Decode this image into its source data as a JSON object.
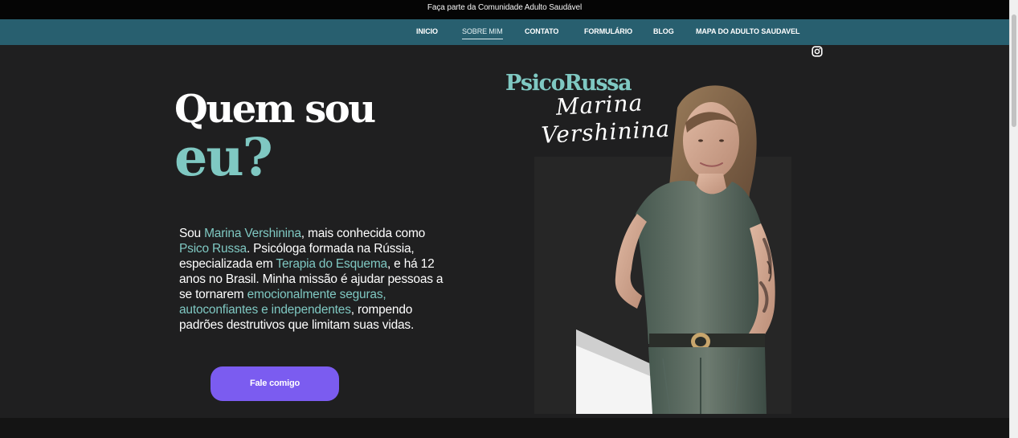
{
  "announcement": {
    "text": "Faça parte da Comunidade Adulto Saudável"
  },
  "nav": {
    "items": [
      "INICIO",
      "SOBRE MIM",
      "CONTATO",
      "FORMULÁRIO",
      "BLOG",
      "MAPA DO ADULTO SAUDAVEL"
    ],
    "active_item": "SOBRE MIM",
    "social_icon": "instagram-icon"
  },
  "hero": {
    "title_line1": "Quem sou",
    "title_line2": "eu?",
    "bio_parts": [
      "Sou ",
      "Marina Vershinina",
      ", mais conhecida como ",
      "Psico Russa",
      ". Psicóloga formada na Rússia, especializada em ",
      "Terapia do Esquema",
      ", e há 12 anos no Brasil. Minha missão é ajudar pessoas a se tornarem ",
      "emocionalmente seguras, autoconfiantes e independentes",
      ", rompendo padrões destrutivos que limitam suas vidas."
    ],
    "cta_label": "Fale comigo"
  },
  "branding": {
    "brand_name": "PsicoRussa",
    "script_line1": "Marina",
    "script_line2": "Vershinina"
  },
  "colors": {
    "announcement_bg": "#050505",
    "nav_bg": "#285f6f",
    "page_bg": "#1f1f20",
    "accent_teal": "#7fc8c2",
    "button_purple": "#7b5cf0",
    "text_white": "#ffffff"
  }
}
